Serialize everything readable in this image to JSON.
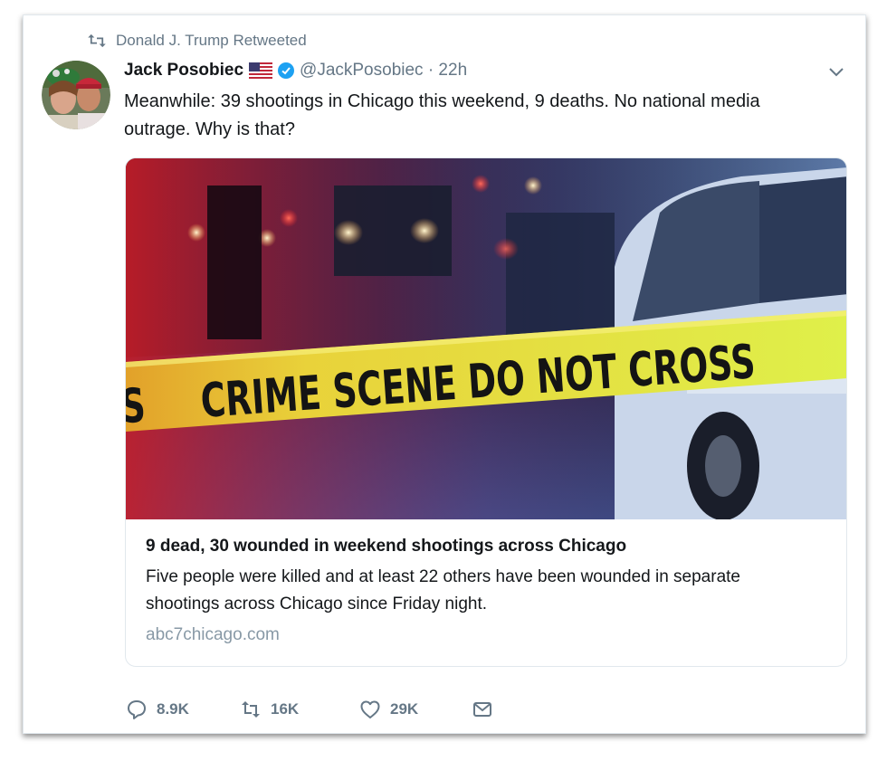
{
  "retweet_context": {
    "text": "Donald J. Trump Retweeted",
    "icon": "retweet-icon"
  },
  "author": {
    "name": "Jack Posobiec",
    "flag_icon": "us-flag-icon",
    "verified_icon": "verified-badge-icon",
    "handle_time": "@JackPosobiec · 22h"
  },
  "tweet": {
    "text": "Meanwhile: 39 shootings in Chicago this weekend, 9 deaths. No national media outrage. Why is that?"
  },
  "link_card": {
    "image_text": "CRIME SCENE DO NOT CROSS",
    "image_text_fragment": "S",
    "title": "9 dead, 30 wounded in weekend shootings across Chicago",
    "description": "Five people were killed and at least 22 others have been wounded in separate shootings across Chicago since Friday night.",
    "domain": "abc7chicago.com"
  },
  "actions": {
    "reply_count": "8.9K",
    "retweet_count": "16K",
    "like_count": "29K"
  },
  "colors": {
    "secondary_text": "#657786",
    "verified_blue": "#1da1f2",
    "tape_yellow": "#e6e437"
  }
}
